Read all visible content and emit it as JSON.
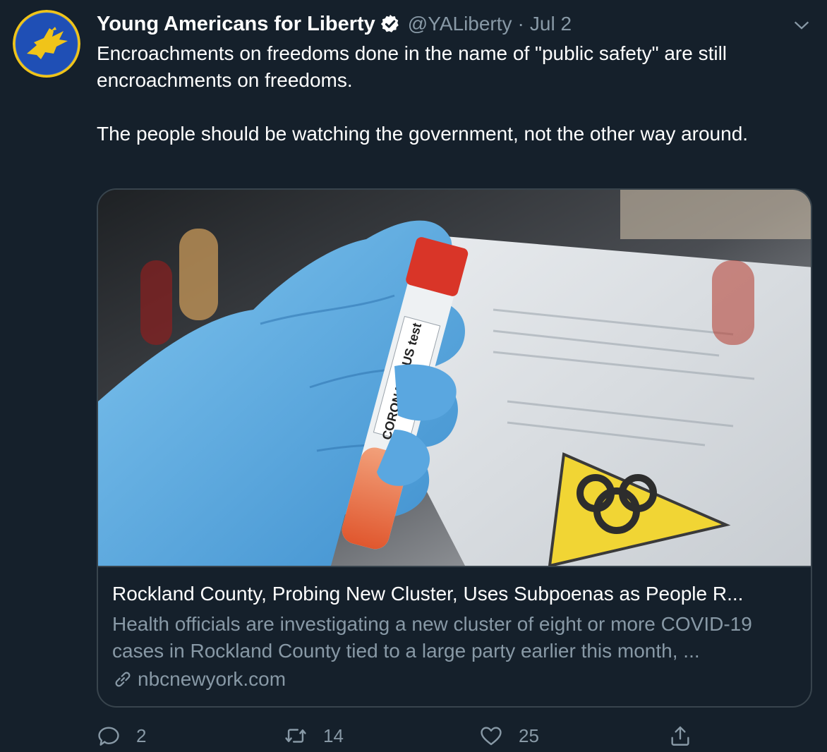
{
  "tweet": {
    "author_name": "Young Americans for Liberty",
    "handle": "@YALiberty",
    "separator": "·",
    "date": "Jul 2",
    "paragraphs": [
      "Encroachments on freedoms done in the name of \"public safety\" are still encroachments on freedoms.",
      "The people should be watching the government, not the other way around."
    ]
  },
  "card": {
    "image_label": "CORONAVIRUS test",
    "title": "Rockland County, Probing New Cluster, Uses Subpoenas as People R...",
    "description": "Health officials are investigating a new cluster of eight or more COVID-19 cases in Rockland County tied to a large party earlier this month, ...",
    "domain": "nbcnewyork.com"
  },
  "actions": {
    "replies": "2",
    "retweets": "14",
    "likes": "25"
  },
  "icons": {
    "verified": "verified-badge-icon",
    "caret": "chevron-down-icon",
    "link": "link-icon",
    "reply": "reply-icon",
    "retweet": "retweet-icon",
    "like": "heart-icon",
    "share": "share-icon"
  },
  "colors": {
    "background": "#15202b",
    "secondary_text": "#8899a6",
    "border": "#38444d",
    "avatar_blue": "#1f4fb5",
    "avatar_gold": "#f0c419"
  }
}
